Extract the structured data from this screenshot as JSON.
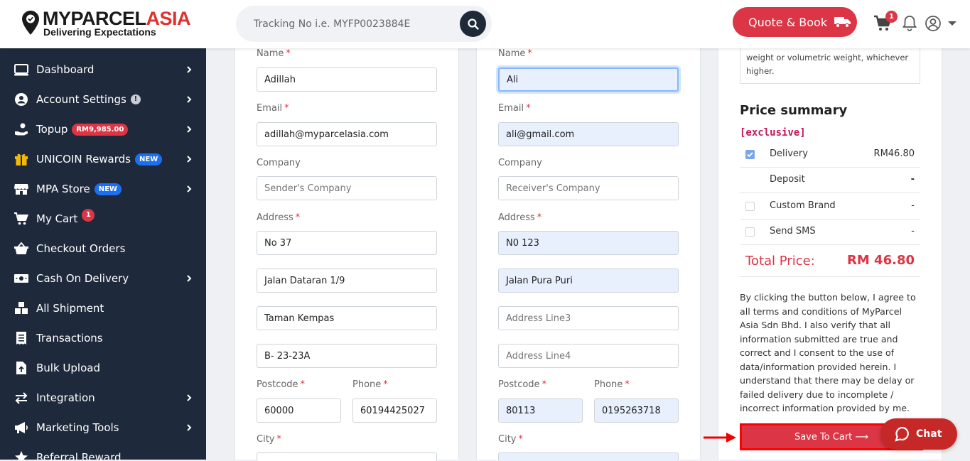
{
  "brand": {
    "name_main": "MYPARCEL",
    "name_accent": "ASIA",
    "tagline": "Delivering Expectations"
  },
  "search": {
    "placeholder": "Tracking No i.e. MYFP0023884E"
  },
  "header": {
    "quote_label": "Quote & Book",
    "cart_count": "1"
  },
  "sidebar": {
    "items": [
      {
        "label": "Dashboard",
        "icon": "monitor-icon"
      },
      {
        "label": "Account Settings",
        "icon": "user-circle-icon",
        "info": "!"
      },
      {
        "label": "Topup",
        "icon": "hand-coin-icon",
        "badge": "RM9,985.00"
      },
      {
        "label": "UNICOIN Rewards",
        "icon": "gift-icon",
        "badge": "NEW"
      },
      {
        "label": "MPA Store",
        "icon": "store-icon",
        "badge": "NEW"
      },
      {
        "label": "My Cart",
        "icon": "cart-icon",
        "badge": "1"
      },
      {
        "label": "Checkout Orders",
        "icon": "basket-icon"
      },
      {
        "label": "Cash On Delivery",
        "icon": "cash-icon"
      },
      {
        "label": "All Shipment",
        "icon": "boxes-icon"
      },
      {
        "label": "Transactions",
        "icon": "receipt-icon"
      },
      {
        "label": "Bulk Upload",
        "icon": "file-upload-icon"
      },
      {
        "label": "Integration",
        "icon": "arrows-exchange-icon"
      },
      {
        "label": "Marketing Tools",
        "icon": "megaphone-icon"
      },
      {
        "label": "Referral Reward",
        "icon": "star-icon"
      }
    ]
  },
  "form": {
    "labels": {
      "name": "Name",
      "email": "Email",
      "company": "Company",
      "address": "Address",
      "postcode": "Postcode",
      "phone": "Phone",
      "city": "City",
      "req": "*"
    },
    "sender": {
      "name": "Adillah",
      "email": "adillah@myparcelasia.com",
      "company_placeholder": "Sender's Company",
      "address1": "No 37",
      "address2": "Jalan Dataran 1/9",
      "address3": "Taman Kempas",
      "address4": "B- 23-23A",
      "postcode": "60000",
      "phone": "60194425027"
    },
    "receiver": {
      "name": "Ali",
      "email": "ali@gmail.com",
      "company_placeholder": "Receiver's Company",
      "address1": "N0 123",
      "address2": "Jalan Pura Puri",
      "address3_placeholder": "Address Line3",
      "address4_placeholder": "Address Line4",
      "postcode": "80113",
      "phone": "0195263718"
    }
  },
  "summary": {
    "note": "weight or volumetric weight, whichever higher.",
    "title": "Price summary",
    "tag": "[exclusive]",
    "rows": [
      {
        "name": "Delivery",
        "price": "RM46.80",
        "checked": true
      },
      {
        "name": "Deposit",
        "price": "-"
      },
      {
        "name": "Custom Brand",
        "price": "-",
        "checked": false
      },
      {
        "name": "Send SMS",
        "price": "-",
        "checked": false
      }
    ],
    "total_label": "Total Price:",
    "total_value": "RM 46.80",
    "terms": "By clicking the button below, I agree to all terms and conditions of MyParcel Asia Sdn Bhd. I also verify that all information submitted are true and correct and I consent to the use of data/information provided herein. I understand that there may be delay or failed delivery due to incomplete / incorrect information provided by me.",
    "save_label": "Save To Cart ⟶"
  },
  "chat": {
    "label": "Chat"
  },
  "colors": {
    "primary": "#dc3545",
    "sidebar": "#1e2a3b",
    "accent_blue": "#1e6ff0",
    "tag_pink": "#c2185b"
  }
}
